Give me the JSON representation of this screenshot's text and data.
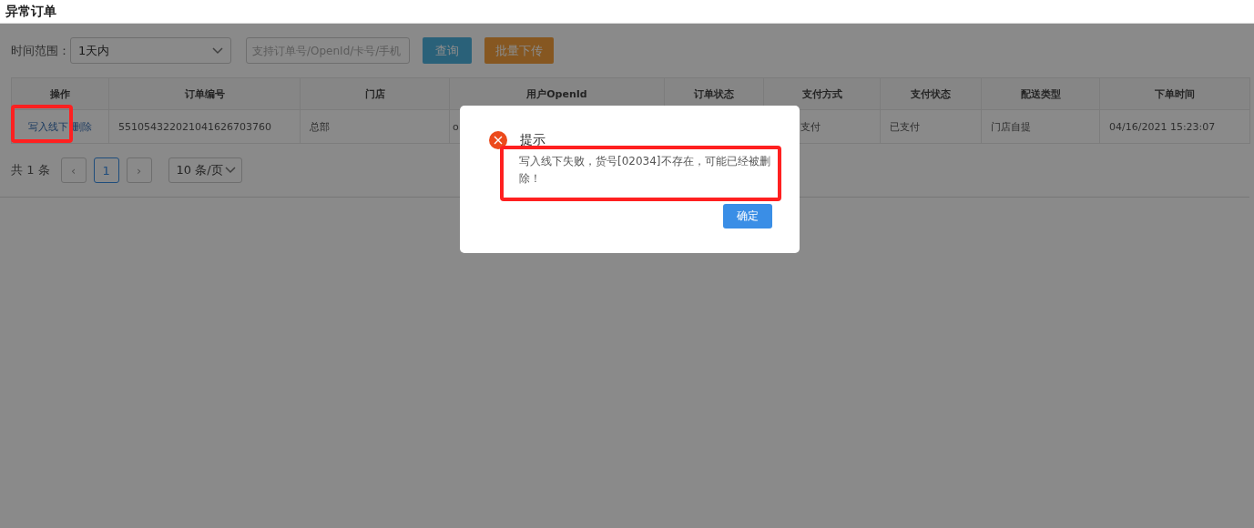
{
  "page_title": "异常订单",
  "filters": {
    "time_range_label": "时间范围：",
    "time_range": "1天内",
    "search": {
      "placeholder": "支持订单号/OpenId/卡号/手机"
    },
    "buttons": [
      {
        "label": "查询",
        "kind": "primary"
      },
      {
        "label": "批量下传",
        "kind": "warning"
      }
    ]
  },
  "table": {
    "columns": [
      "操作",
      "订单编号",
      "门店",
      "用户OpenId",
      "订单状态",
      "支付方式",
      "支付状态",
      "配送类型",
      "下单时间"
    ],
    "rows": [
      {
        "cells": [
          {
            "actions": [
              {
                "label": "写入线下",
                "highlighted": true
              },
              {
                "label": "删除",
                "highlighted": false
              }
            ]
          },
          "551054322021041626703760",
          "总部",
          "o",
          null,
          "支付",
          "已支付",
          "门店自提",
          "04/16/2021 15:23:07"
        ]
      }
    ]
  },
  "pagination": {
    "total": "共 1 条",
    "prev": "‹",
    "pages": [
      {
        "label": "1",
        "selected": true
      }
    ],
    "next": "›",
    "page_size": "10 条/页"
  },
  "dialog": {
    "title": "提示",
    "message": "写入线下失败，货号[02034]不存在，可能已经被删除！",
    "message_highlighted": true,
    "ok": "确定"
  }
}
